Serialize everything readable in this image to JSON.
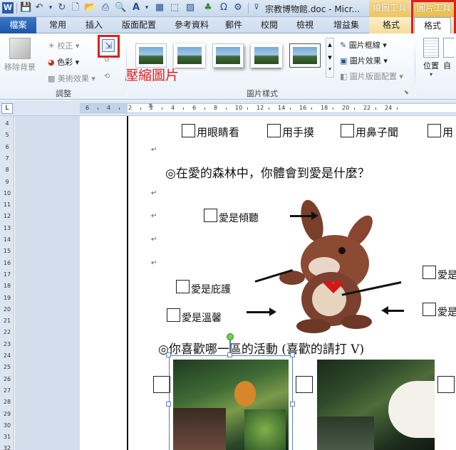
{
  "window": {
    "title": "宗教博物館.doc - Micr...",
    "context_group_drawing": "繪圖工具",
    "context_group_picture": "圖片工具"
  },
  "tabs": {
    "file": "檔案",
    "items": [
      "常用",
      "插入",
      "版面配置",
      "參考資料",
      "郵件",
      "校閱",
      "檢視",
      "增益集"
    ],
    "drawing_format": "格式",
    "picture_format": "格式"
  },
  "ribbon": {
    "remove_background": "移除背景",
    "corrections": "校正",
    "color": "色彩",
    "artistic_effects": "美術效果",
    "adjust_group": "調整",
    "compress_callout": "壓縮圖片",
    "picture_border": "圖片框線",
    "picture_effects": "圖片效果",
    "picture_layout": "圖片版面配置",
    "picture_styles_group": "圖片樣式",
    "position": "位置",
    "wrap_partial": "自"
  },
  "ruler": {
    "top_numbers": [
      "6",
      "4",
      "2",
      "2",
      "4",
      "6",
      "8",
      "10",
      "12",
      "14",
      "16",
      "18",
      "20",
      "22",
      "24"
    ],
    "left_numbers": [
      "4",
      "5",
      "6",
      "7",
      "8",
      "9",
      "10",
      "11",
      "12",
      "13",
      "14",
      "15",
      "16",
      "17",
      "18",
      "19",
      "20",
      "21",
      "22",
      "23",
      "24",
      "25",
      "26",
      "27",
      "28",
      "29",
      "30",
      "31",
      "32"
    ]
  },
  "document": {
    "senses": [
      "用眼睛看",
      "用手摸",
      "用鼻子聞",
      "用"
    ],
    "question1": "◎在愛的森林中，你體會到愛是什麼？",
    "love_options_left": [
      "愛是傾聽",
      "愛是庇護",
      "愛是溫馨"
    ],
    "love_options_right": [
      "愛是",
      "愛是"
    ],
    "question2": "◎你喜歡哪一區的活動 (喜歡的請打 V)",
    "paragraph_mark": "↵"
  }
}
